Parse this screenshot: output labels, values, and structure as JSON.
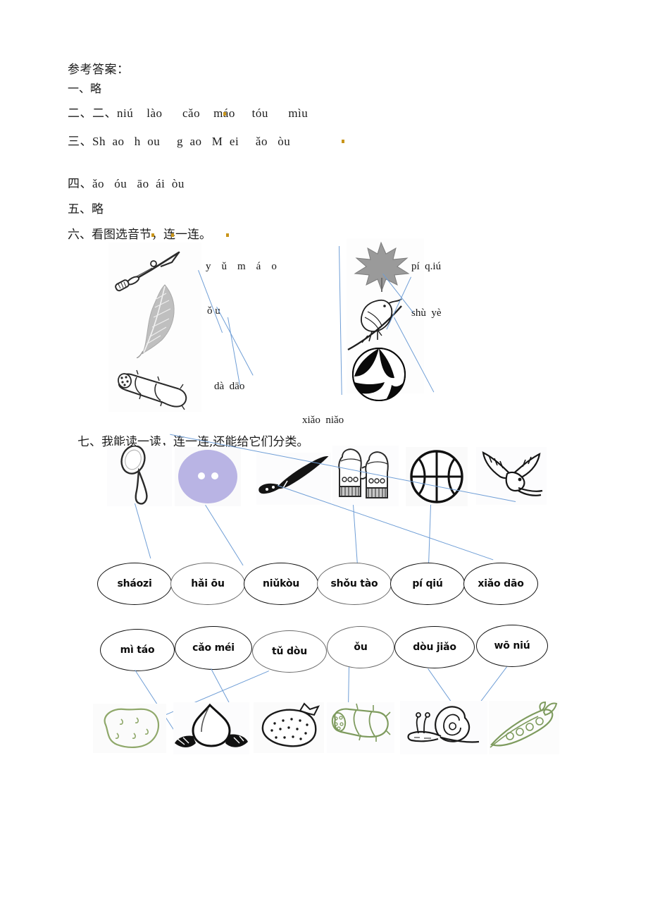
{
  "document": {
    "title": "参考答案：",
    "answers": [
      {
        "id": "q1",
        "label": "一、略"
      },
      {
        "id": "q2",
        "label": "二、二、niú    lào      cǎo    máo     tóu      mìu"
      },
      {
        "id": "q3",
        "label": "三、Sh  ao   h  ou     g  ao   M  ei     ǎo   òu"
      },
      {
        "id": "q4",
        "label": "四、ǎo   óu   āo  ái  òu"
      },
      {
        "id": "q5",
        "label": "五、略"
      },
      {
        "id": "q6",
        "label": "六、看图选音节，连一连。"
      },
      {
        "id": "q7",
        "label": "七、我能读一读，连一连,还能给它们分类。"
      }
    ]
  },
  "section_six": {
    "heading": "六、看图选音节，连一连。",
    "pictures": [
      {
        "name": "sword-picture",
        "alt": "dà dāo"
      },
      {
        "name": "feather-picture",
        "alt": "yǔ máo"
      },
      {
        "name": "lotus-root-picture",
        "alt": "ǒu"
      },
      {
        "name": "maple-leaf-picture",
        "alt": "shù yè"
      },
      {
        "name": "bird-picture",
        "alt": "xiǎo niǎo"
      },
      {
        "name": "beach-ball-picture",
        "alt": "pí qiú"
      }
    ],
    "syllables": [
      {
        "name": "syllable-yumao",
        "text": "y    ǔ    m    á    o"
      },
      {
        "name": "syllable-ou",
        "text": "ǒ u"
      },
      {
        "name": "syllable-dadao",
        "text": "dà  dāo"
      },
      {
        "name": "syllable-piqiu",
        "text": "pí  q.iú"
      },
      {
        "name": "syllable-shuye",
        "text": "shù  yè"
      },
      {
        "name": "syllable-xiaoniao",
        "text": "xiǎo  niǎo"
      }
    ]
  },
  "section_seven": {
    "heading": "七、我能读一读，连一连,还能给它们分类。",
    "row1_pictures": [
      {
        "name": "spoon-picture",
        "alt": "sháozi"
      },
      {
        "name": "button-picture",
        "alt": "niǔkòu",
        "color": "#b9b4e4"
      },
      {
        "name": "knife-picture",
        "alt": "xiǎodāo"
      },
      {
        "name": "mittens-picture",
        "alt": "shǒutào"
      },
      {
        "name": "basketball-picture",
        "alt": "píqiú"
      },
      {
        "name": "seagull-picture",
        "alt": "hǎi ōu"
      }
    ],
    "row1_ovals": [
      {
        "name": "oval-shaozi",
        "text": "sháozi"
      },
      {
        "name": "oval-haiou",
        "text": "hǎi ōu"
      },
      {
        "name": "oval-niukou",
        "text": "niǔkòu"
      },
      {
        "name": "oval-shoutao",
        "text": "shǒu tào"
      },
      {
        "name": "oval-piqiu",
        "text": "pí qiú"
      },
      {
        "name": "oval-xiaodao",
        "text": "xiǎo dāo"
      }
    ],
    "row2_ovals": [
      {
        "name": "oval-mitao",
        "text": "mì táo"
      },
      {
        "name": "oval-caomei",
        "text": "cǎo méi"
      },
      {
        "name": "oval-tudou",
        "text": "tǔ dòu"
      },
      {
        "name": "oval-ou",
        "text": "ǒu"
      },
      {
        "name": "oval-doujiao",
        "text": "dòu jiǎo"
      },
      {
        "name": "oval-woniu",
        "text": "wō niú"
      }
    ],
    "row2_pictures": [
      {
        "name": "potato-picture",
        "alt": "tǔ dòu",
        "color": "#8fa86a"
      },
      {
        "name": "peach-picture",
        "alt": "mì táo",
        "color": "#111111"
      },
      {
        "name": "strawberry-picture",
        "alt": "cǎo méi",
        "color": "#111111"
      },
      {
        "name": "lotus-root-picture",
        "alt": "ǒu",
        "color": "#7e9b5e"
      },
      {
        "name": "snail-picture",
        "alt": "wō niú",
        "color": "#1b1b1b"
      },
      {
        "name": "green-bean-picture",
        "alt": "dòu jiǎo",
        "color": "#7e9b5e"
      }
    ]
  },
  "colors": {
    "link_line": "#6f9ed6",
    "ink": "#1a1a1a",
    "paper": "#ffffff",
    "button_purple": "#b9b4e4",
    "green_ink": "#7e9b5e",
    "artifact_orange": "#c9951a"
  }
}
